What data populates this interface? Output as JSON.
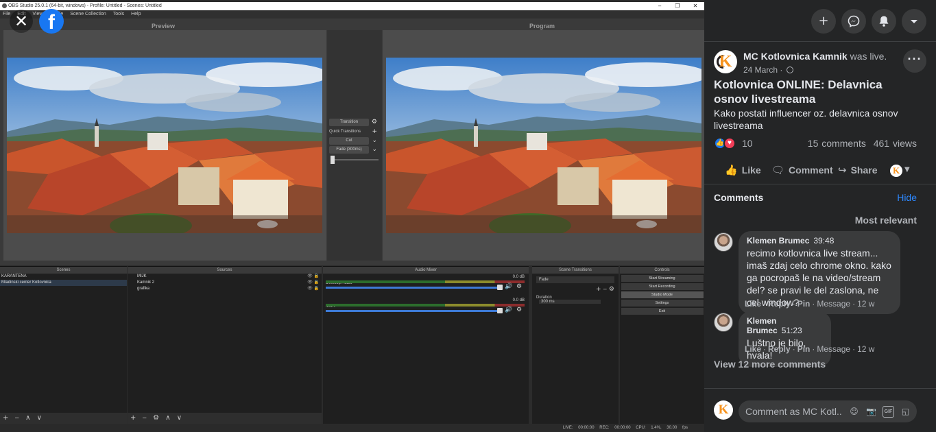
{
  "video": {
    "obs_title": "OBS Studio 25.0.1 (64-bit, windows) - Profile: Untitled - Scenes: Untitled",
    "window_controls": [
      "‒",
      "❐",
      "✕"
    ],
    "menu": [
      "File",
      "Edit",
      "View",
      "Profile",
      "Scene Collection",
      "Tools",
      "Help"
    ],
    "preview_label": "Preview",
    "program_label": "Program",
    "transition": {
      "button": "Transition",
      "quick_label": "Quick Transitions",
      "cut": "Cut",
      "fade": "Fade (300ms)"
    },
    "docks": {
      "scenes": {
        "title": "Scenes",
        "items": [
          "KARANTENA",
          "Mladinski center Kotlovnica"
        ],
        "footer": "+ ‒ ∧ ∨"
      },
      "sources": {
        "title": "Sources",
        "items": [
          "MIJK",
          "Kamnik 2",
          "grafika"
        ],
        "footer": "+ ‒ ⚙ ∧ ∨"
      },
      "mixer": {
        "title": "Audio Mixer",
        "channels": [
          {
            "name": "Desktop Audio",
            "db": "0.0 dB"
          },
          {
            "name": "MIJK",
            "db": "0.0 dB"
          }
        ]
      },
      "scene_transitions": {
        "title": "Scene Transitions",
        "type": "Fade",
        "duration_label": "Duration",
        "duration_value": "300 ms"
      },
      "controls": {
        "title": "Controls",
        "buttons": [
          "Start Streaming",
          "Start Recording",
          "Studio Mode",
          "Settings",
          "Exit"
        ]
      }
    },
    "status": {
      "live": "LIVE: 00:00:00",
      "rec": "REC: 00:00:00",
      "cpu": "CPU: 1.4%, 30.00 fps"
    }
  },
  "overlay": {
    "close_icon": "✕",
    "facebook_logo": "f"
  },
  "sidebar": {
    "top_actions": [
      {
        "icon": "plus-icon",
        "glyph": "+"
      },
      {
        "icon": "messenger-icon",
        "glyph": "✉"
      },
      {
        "icon": "notifications-icon",
        "glyph": "🔔"
      },
      {
        "icon": "account-caret-icon",
        "glyph": "▾"
      }
    ],
    "post": {
      "author": "MC Kotlovnica Kamnik",
      "status": "was live.",
      "date": "24 March ·",
      "more": "···",
      "title": "Kotlovnica ONLINE: Delavnica osnov livestreama",
      "description": "Kako postati influencer oz. delavnica osnov livestreama",
      "reaction_count": "10",
      "comments_count": "15 comments",
      "views_count": "461 views"
    },
    "actions": {
      "like": "Like",
      "comment": "Comment",
      "share": "Share"
    },
    "comments": {
      "heading": "Comments",
      "hide": "Hide",
      "sort": "Most relevant",
      "items": [
        {
          "author": "Klemen Brumec",
          "timestamp": "39:48",
          "text": "recimo kotlovnica live stream... imaš zdaj celo chrome okno. kako ga pocropaš le na video/stream del? se pravi le del zaslona, ne cel window?",
          "like": "Like",
          "reply": "Reply",
          "pin": "Pin",
          "message": "Message",
          "age": "12 w"
        },
        {
          "author": "Klemen Brumec",
          "timestamp": "51:23",
          "text": "Luštno je bilo, hvala!",
          "like": "Like",
          "reply": "Reply",
          "pin": "Pin",
          "message": "Message",
          "age": "12 w"
        }
      ],
      "view_more": "View 12 more comments",
      "composer_placeholder": "Comment as MC Kotl..."
    },
    "colors": {
      "bg": "#242526",
      "accent": "#2d88ff",
      "brand_orange": "#f7931e"
    }
  }
}
